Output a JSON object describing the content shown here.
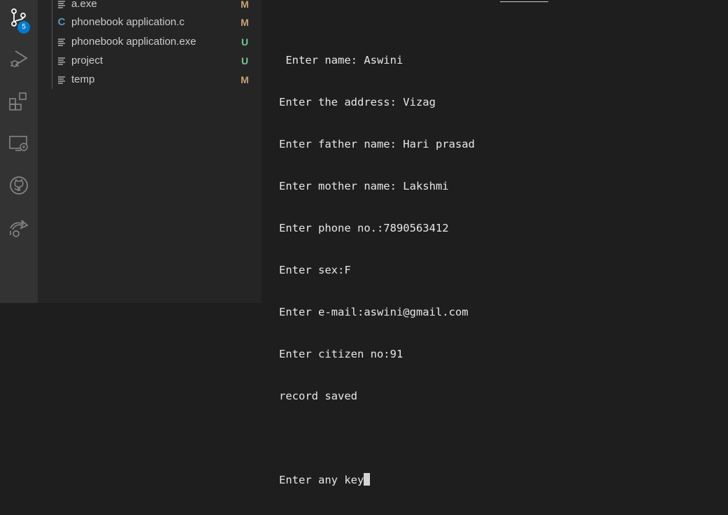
{
  "activity_bar": {
    "source_control_badge": "5",
    "icons": [
      "source-control-icon",
      "run-debug-icon",
      "extensions-icon",
      "remote-explorer-icon",
      "github-icon",
      "live-share-icon"
    ]
  },
  "explorer": {
    "files": [
      {
        "name": "a.exe",
        "status": "M",
        "icon": "file-lines-icon"
      },
      {
        "name": "phonebook application.c",
        "status": "M",
        "icon": "c-file-icon"
      },
      {
        "name": "phonebook application.exe",
        "status": "U",
        "icon": "file-lines-icon"
      },
      {
        "name": "project",
        "status": "U",
        "icon": "file-lines-icon"
      },
      {
        "name": "temp",
        "status": "M",
        "icon": "file-lines-icon"
      }
    ]
  },
  "terminal": {
    "lines": [
      " Enter name: Aswini",
      "Enter the address: Vizag",
      "Enter father name: Hari prasad",
      "Enter mother name: Lakshmi",
      "Enter phone no.:7890563412",
      "Enter sex:F",
      "Enter e-mail:aswini@gmail.com",
      "Enter citizen no:91",
      "record saved",
      "",
      "Enter any key"
    ]
  },
  "colors": {
    "activity_bar_bg": "#333333",
    "sidebar_bg": "#252526",
    "terminal_bg": "#1e1e1e",
    "badge": "#007acc",
    "modified": "#c9a26d",
    "untracked": "#73c991"
  }
}
